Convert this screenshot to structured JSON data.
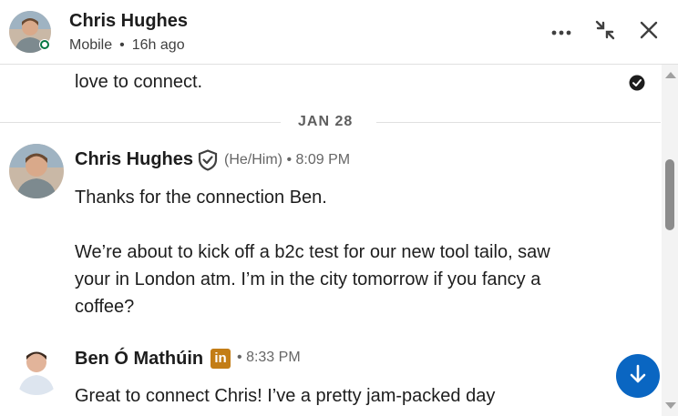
{
  "header": {
    "name": "Chris Hughes",
    "device": "Mobile",
    "separator": "•",
    "last_active": "16h ago"
  },
  "thread": {
    "partial_text": "love to connect.",
    "date_divider": "JAN 28",
    "messages": [
      {
        "sender": "Chris Hughes",
        "pronouns": "(He/Him)",
        "meta_sep": "•",
        "time": "8:09 PM",
        "text": "Thanks for the connection Ben.\n\nWe’re about to kick off a b2c test for our new tool tailo, saw\nyour in London atm. I’m in the city tomorrow if you fancy a\ncoffee?"
      },
      {
        "sender": "Ben Ó Mathúin",
        "badge": "in",
        "meta_sep": "•",
        "time": "8:33 PM",
        "text": "Great to connect Chris! I’ve a pretty jam-packed day"
      }
    ]
  },
  "colors": {
    "accent": "#0a66c2",
    "presence": "#057642",
    "linkedin_badge": "#c37d16"
  },
  "icons": {
    "more": "more-icon",
    "minimize": "minimize-icon",
    "close": "close-icon",
    "verified": "verified-shield-icon",
    "seen": "seen-check-icon",
    "scroll_down": "arrow-down-icon"
  }
}
